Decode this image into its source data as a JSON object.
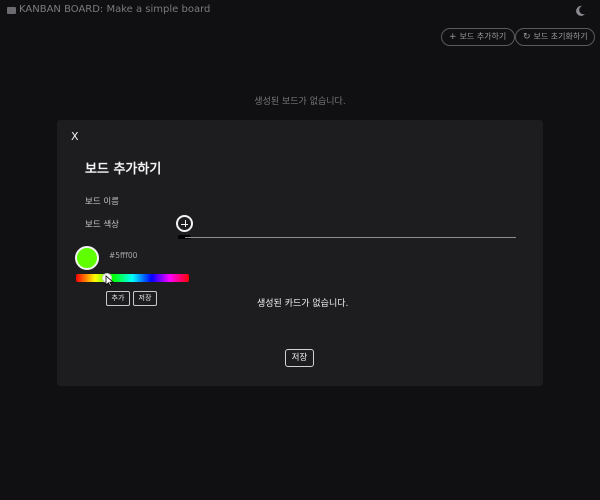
{
  "header": {
    "title": "KANBAN BOARD: Make a simple board",
    "logo_icon": "board-icon",
    "theme_icon": "moon-icon"
  },
  "toolbar": {
    "add_board_label": "보드 추가하기",
    "add_board_icon": "plus-icon",
    "reset_board_label": "보드 초기화하기",
    "reset_board_icon": "refresh-icon"
  },
  "main": {
    "empty_boards_text": "생성된 보드가 없습니다."
  },
  "modal": {
    "close_label": "X",
    "title": "보드 추가하기",
    "board_name_label": "보드 이름",
    "board_name_value": "",
    "board_color_label": "보드 색상",
    "add_color_icon": "plus-circle-icon",
    "selected_color": "#5fff00",
    "hex_value": "#5fff00",
    "hue_level": 0.27,
    "color_add_label": "추가",
    "color_save_label": "저장",
    "empty_cards_text": "생성된 카드가 없습니다.",
    "save_label": "저장"
  }
}
